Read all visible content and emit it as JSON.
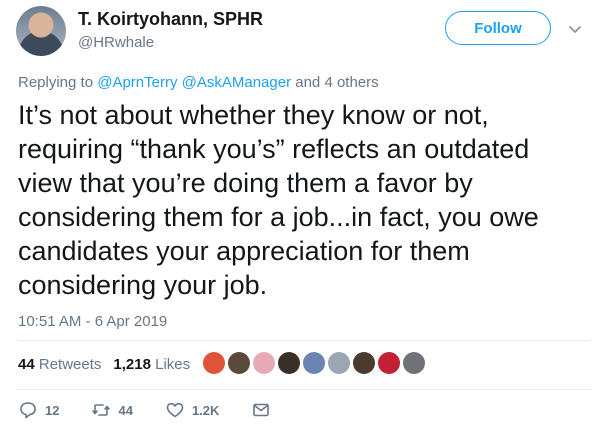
{
  "author": {
    "name": "T. Koirtyohann, SPHR",
    "handle": "@HRwhale"
  },
  "follow_label": "Follow",
  "reply": {
    "prefix": "Replying to",
    "mentions": "@AprnTerry @AskAManager",
    "suffix": "and 4 others"
  },
  "tweet_text": "It’s not about whether they know or not, requiring “thank you’s” reflects an outdated view that you’re doing them a favor by considering them for a job...in fact, you owe candidates your appreciation for them considering your job.",
  "timestamp": "10:51 AM - 6 Apr 2019",
  "stats": {
    "retweets_count": "44",
    "retweets_label": "Retweets",
    "likes_count": "1,218",
    "likes_label": "Likes"
  },
  "liker_avatar_colors": [
    "#e0533a",
    "#5a4a3c",
    "#e8a9b8",
    "#3a3028",
    "#6a86b0",
    "#9aa6b2",
    "#4b3a2e",
    "#c22035",
    "#6f7377"
  ],
  "actions": {
    "replies": "12",
    "retweets": "44",
    "likes": "1.2K"
  },
  "icons": [
    "chevron-down-icon",
    "reply-icon",
    "retweet-icon",
    "heart-icon",
    "message-icon"
  ]
}
